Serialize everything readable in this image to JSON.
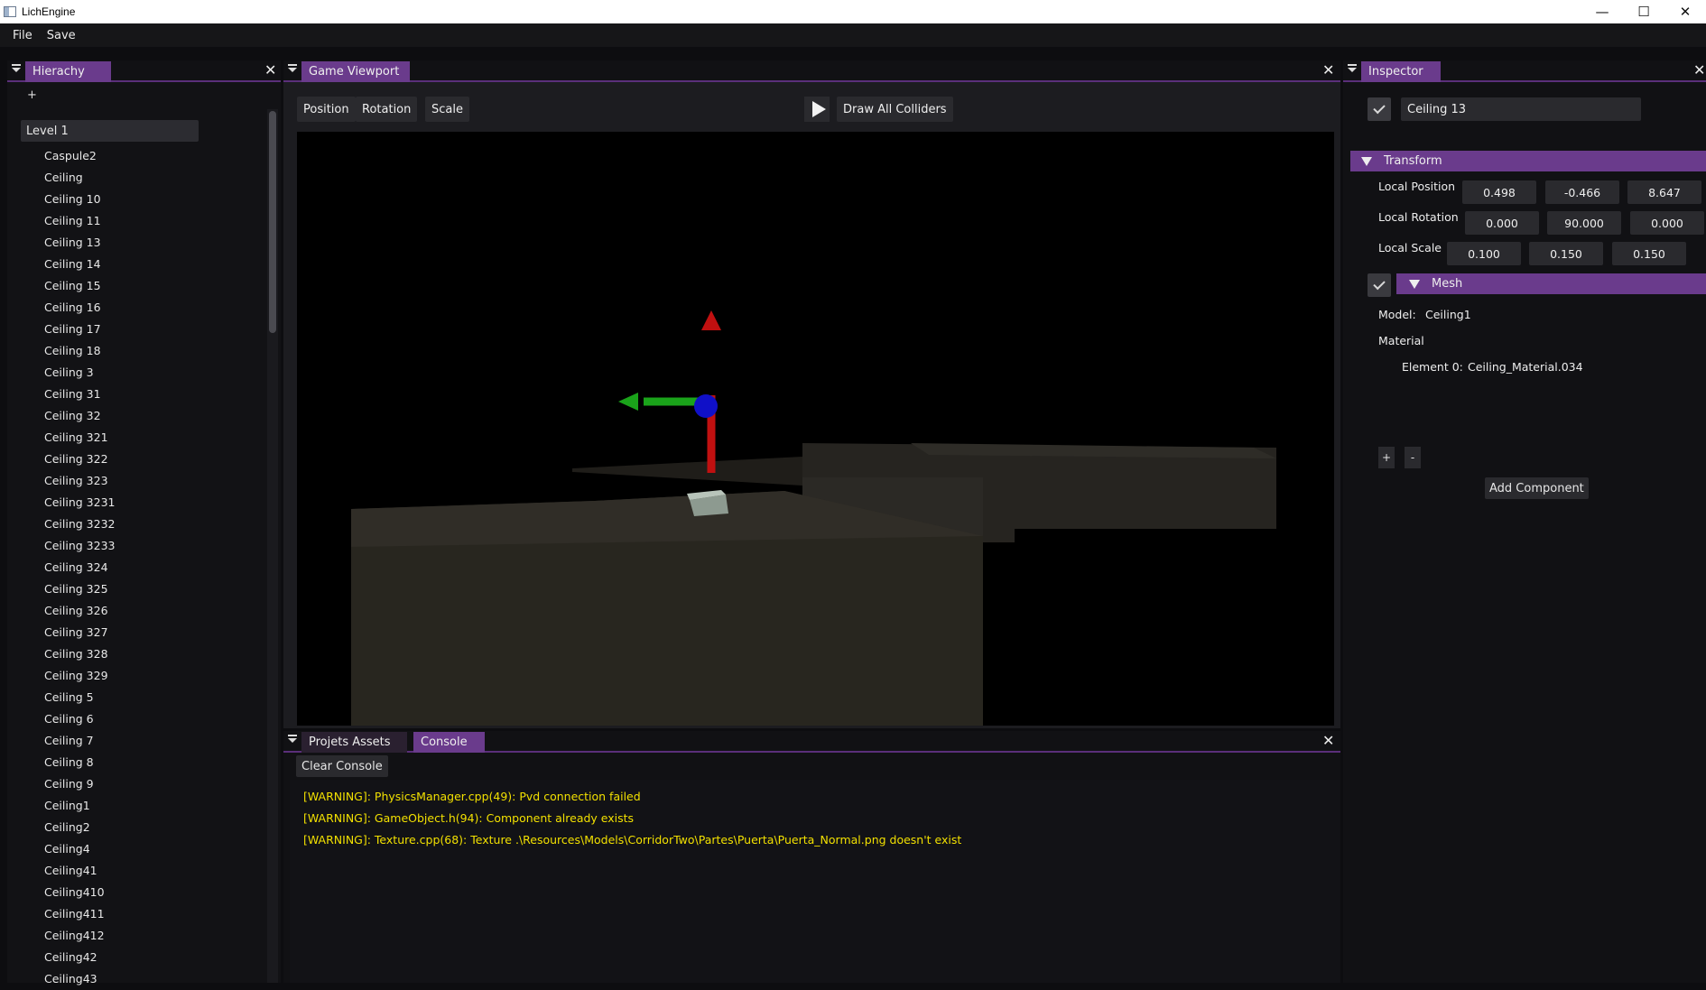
{
  "window": {
    "title": "LichEngine",
    "minimize": "—",
    "maximize": "☐",
    "close": "✕"
  },
  "menu": {
    "file": "File",
    "save": "Save"
  },
  "hierarchy": {
    "tab": "Hierachy",
    "add": "+",
    "root": "Level 1",
    "items": [
      "Caspule2",
      "Ceiling",
      "Ceiling 10",
      "Ceiling 11",
      "Ceiling 13",
      "Ceiling 14",
      "Ceiling 15",
      "Ceiling 16",
      "Ceiling 17",
      "Ceiling 18",
      "Ceiling 3",
      "Ceiling 31",
      "Ceiling 32",
      "Ceiling 321",
      "Ceiling 322",
      "Ceiling 323",
      "Ceiling 3231",
      "Ceiling 3232",
      "Ceiling 3233",
      "Ceiling 324",
      "Ceiling 325",
      "Ceiling 326",
      "Ceiling 327",
      "Ceiling 328",
      "Ceiling 329",
      "Ceiling 5",
      "Ceiling 6",
      "Ceiling 7",
      "Ceiling 8",
      "Ceiling 9",
      "Ceiling1",
      "Ceiling2",
      "Ceiling4",
      "Ceiling41",
      "Ceiling410",
      "Ceiling411",
      "Ceiling412",
      "Ceiling42",
      "Ceiling43"
    ]
  },
  "viewport": {
    "tab": "Game Viewport",
    "tools": {
      "position": "Position",
      "rotation": "Rotation",
      "scale": "Scale"
    },
    "draw_colliders": "Draw All Colliders"
  },
  "bottom": {
    "tab_assets": "Projets Assets",
    "tab_console": "Console",
    "clear": "Clear Console",
    "logs": [
      "[WARNING]: PhysicsManager.cpp(49): Pvd connection failed",
      "[WARNING]: GameObject.h(94): Component already exists",
      "[WARNING]: Texture.cpp(68): Texture .\\Resources\\Models\\CorridorTwo\\Partes\\Puerta\\Puerta_Normal.png doesn't exist"
    ]
  },
  "inspector": {
    "tab": "Inspector",
    "name": "Ceiling 13",
    "transform": {
      "header": "Transform",
      "pos_label": "Local Position",
      "rot_label": "Local Rotation",
      "scale_label": "Local Scale",
      "position": [
        "0.498",
        "-0.466",
        "8.647"
      ],
      "rotation": [
        "0.000",
        "90.000",
        "0.000"
      ],
      "scale": [
        "0.100",
        "0.150",
        "0.150"
      ]
    },
    "mesh": {
      "header": "Mesh",
      "model_label": "Model:",
      "model_value": "Ceiling1",
      "material_label": "Material",
      "element_label": "Element 0:",
      "element_value": "Ceiling_Material.034",
      "plus": "+",
      "minus": "-"
    },
    "add_component": "Add Component"
  },
  "colors": {
    "accent": "#6a3b8c",
    "warning": "#f2e000",
    "gizmo_x": "#1aa31a",
    "gizmo_y": "#c01010",
    "gizmo_center": "#1010c8"
  }
}
